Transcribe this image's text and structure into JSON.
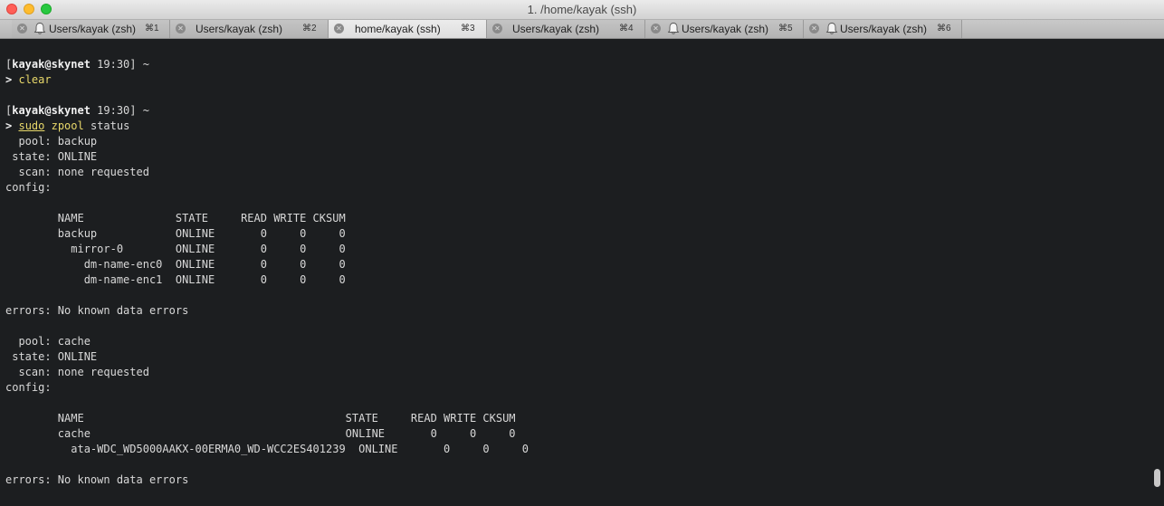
{
  "window": {
    "title": "1. /home/kayak (ssh)"
  },
  "tabs": [
    {
      "label": "Users/kayak (zsh)",
      "shortcut": "⌘1",
      "bell": true,
      "active": false
    },
    {
      "label": "Users/kayak (zsh)",
      "shortcut": "⌘2",
      "bell": false,
      "active": false
    },
    {
      "label": "home/kayak (ssh)",
      "shortcut": "⌘3",
      "bell": false,
      "active": true
    },
    {
      "label": "Users/kayak (zsh)",
      "shortcut": "⌘4",
      "bell": false,
      "active": false
    },
    {
      "label": "Users/kayak (zsh)",
      "shortcut": "⌘5",
      "bell": true,
      "active": false
    },
    {
      "label": "Users/kayak (zsh)",
      "shortcut": "⌘6",
      "bell": true,
      "active": false
    }
  ],
  "terminal": {
    "prompt1": {
      "open": "[",
      "userhost": "kayak@skynet",
      "rest": " 19:30] ~"
    },
    "cmd1": {
      "arrow": ">",
      "cmd": "clear"
    },
    "prompt2": {
      "open": "[",
      "userhost": "kayak@skynet",
      "rest": " 19:30] ~"
    },
    "cmd2": {
      "arrow": ">",
      "sudo": "sudo",
      "prog": "zpool",
      "args": "status"
    },
    "lines": [
      "  pool: backup",
      " state: ONLINE",
      "  scan: none requested",
      "config:",
      "",
      "        NAME              STATE     READ WRITE CKSUM",
      "        backup            ONLINE       0     0     0",
      "          mirror-0        ONLINE       0     0     0",
      "            dm-name-enc0  ONLINE       0     0     0",
      "            dm-name-enc1  ONLINE       0     0     0",
      "",
      "errors: No known data errors",
      "",
      "  pool: cache",
      " state: ONLINE",
      "  scan: none requested",
      "config:",
      "",
      "        NAME                                        STATE     READ WRITE CKSUM",
      "        cache                                       ONLINE       0     0     0",
      "          ata-WDC_WD5000AAKX-00ERMA0_WD-WCC2ES401239  ONLINE       0     0     0",
      "",
      "errors: No known data errors"
    ]
  }
}
